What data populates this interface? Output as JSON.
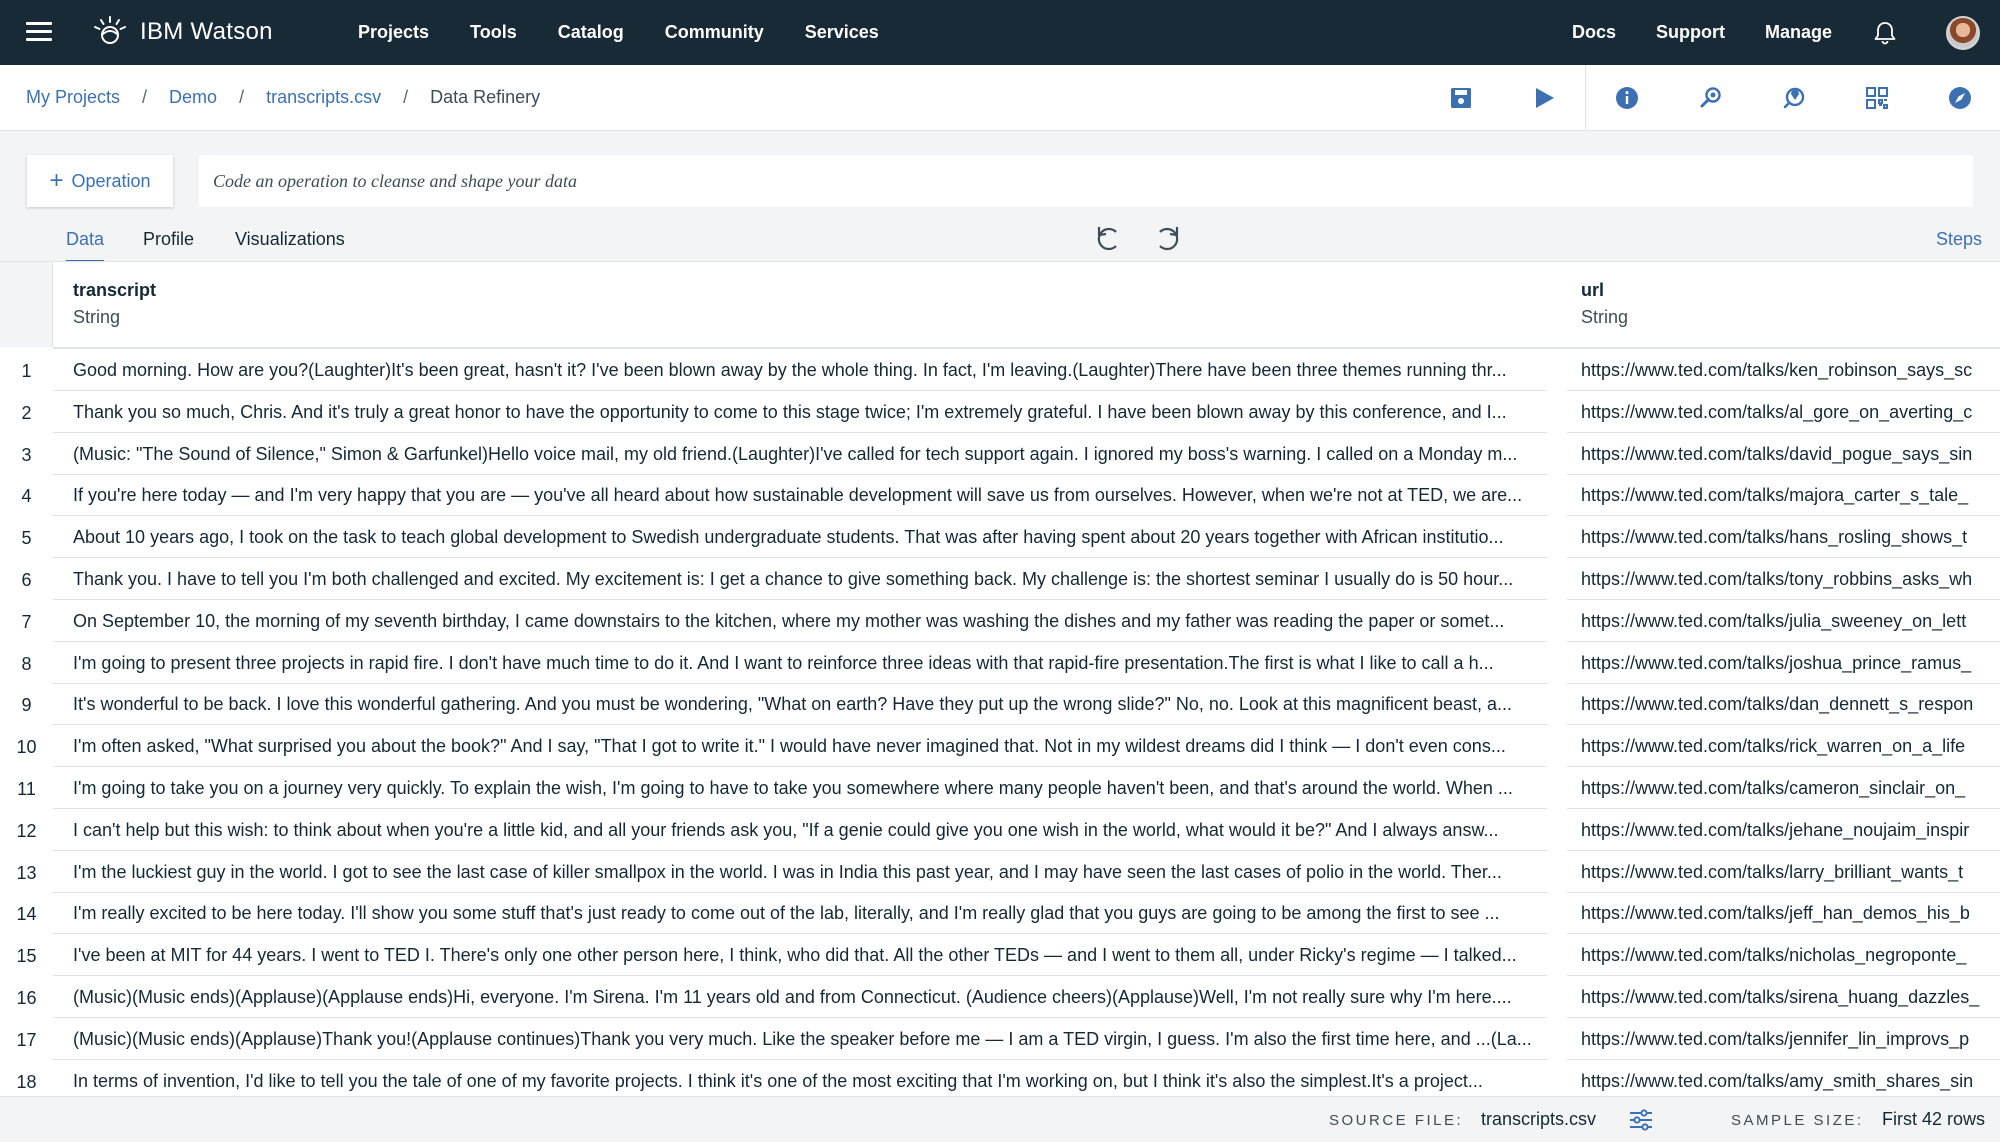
{
  "topnav": {
    "brand_prefix": "IBM",
    "brand_name": "Watson",
    "menu": [
      "Projects",
      "Tools",
      "Catalog",
      "Community",
      "Services"
    ],
    "right_links": [
      "Docs",
      "Support",
      "Manage"
    ],
    "icons": [
      "hamburger-menu-icon",
      "watson-logo-icon",
      "notification-bell-icon",
      "user-avatar"
    ]
  },
  "breadcrumb": {
    "items": [
      "My Projects",
      "Demo",
      "transcripts.csv"
    ],
    "current": "Data Refinery",
    "separator": "/"
  },
  "toolbar_icons": [
    "save-job-icon",
    "run-icon",
    "info-icon",
    "search-data-icon",
    "environment-icon",
    "layout-grid-icon",
    "compass-icon"
  ],
  "operation": {
    "button_label": "Operation",
    "code_placeholder": "Code an operation to cleanse and shape your data"
  },
  "tabs": {
    "items": [
      "Data",
      "Profile",
      "Visualizations"
    ],
    "active": "Data",
    "steps_label": "Steps"
  },
  "table": {
    "columns": [
      {
        "name": "transcript",
        "type": "String"
      },
      {
        "name": "url",
        "type": "String"
      }
    ],
    "rows": [
      {
        "n": "1",
        "transcript": "Good morning. How are you?(Laughter)It's been great, hasn't it? I've been blown away by the whole thing. In fact, I'm leaving.(Laughter)There have been three themes running thr...",
        "url": "https://www.ted.com/talks/ken_robinson_says_sc"
      },
      {
        "n": "2",
        "transcript": "Thank you so much, Chris. And it's truly a great honor to have the opportunity to come to this stage twice; I'm extremely grateful. I have been blown away by this conference, and I...",
        "url": "https://www.ted.com/talks/al_gore_on_averting_c"
      },
      {
        "n": "3",
        "transcript": "(Music: \"The Sound of Silence,\" Simon & Garfunkel)Hello voice mail, my old friend.(Laughter)I've called for tech support again. I ignored my boss's warning. I called on a Monday m...",
        "url": "https://www.ted.com/talks/david_pogue_says_sin"
      },
      {
        "n": "4",
        "transcript": "If you're here today — and I'm very happy that you are — you've all heard about how sustainable development will save us from ourselves. However, when we're not at TED, we are...",
        "url": "https://www.ted.com/talks/majora_carter_s_tale_"
      },
      {
        "n": "5",
        "transcript": "About 10 years ago, I took on the task to teach global development to Swedish undergraduate students. That was after having spent about 20 years together with African institutio...",
        "url": "https://www.ted.com/talks/hans_rosling_shows_t"
      },
      {
        "n": "6",
        "transcript": "Thank you. I have to tell you I'm both challenged and excited. My excitement is: I get a chance to give something back. My challenge is: the shortest seminar I usually do is 50 hour...",
        "url": "https://www.ted.com/talks/tony_robbins_asks_wh"
      },
      {
        "n": "7",
        "transcript": "On September 10, the morning of my seventh birthday, I came downstairs to the kitchen, where my mother was washing the dishes and my father was reading the paper or somet...",
        "url": "https://www.ted.com/talks/julia_sweeney_on_lett"
      },
      {
        "n": "8",
        "transcript": "I'm going to present three projects in rapid fire. I don't have much time to do it. And I want to reinforce three ideas with that rapid-fire presentation.The first is what I like to call a h...",
        "url": "https://www.ted.com/talks/joshua_prince_ramus_"
      },
      {
        "n": "9",
        "transcript": "It's wonderful to be back. I love this wonderful gathering. And you must be wondering, \"What on earth? Have they put up the wrong slide?\" No, no. Look at this magnificent beast, a...",
        "url": "https://www.ted.com/talks/dan_dennett_s_respon"
      },
      {
        "n": "10",
        "transcript": "I'm often asked, \"What surprised you about the book?\" And I say, \"That I got to write it.\" I would have never imagined that. Not in my wildest dreams did I think — I don't even cons...",
        "url": "https://www.ted.com/talks/rick_warren_on_a_life"
      },
      {
        "n": "11",
        "transcript": "I'm going to take you on a journey very quickly. To explain the wish, I'm going to have to take you somewhere where many people haven't been, and that's around the world. When ...",
        "url": "https://www.ted.com/talks/cameron_sinclair_on_"
      },
      {
        "n": "12",
        "transcript": "I can't help but this wish: to think about when you're a little kid, and all your friends ask you, \"If a genie could give you one wish in the world, what would it be?\" And I always answ...",
        "url": "https://www.ted.com/talks/jehane_noujaim_inspir"
      },
      {
        "n": "13",
        "transcript": "I'm the luckiest guy in the world. I got to see the last case of killer smallpox in the world. I was in India this past year, and I may have seen the last cases of polio in the world. Ther...",
        "url": "https://www.ted.com/talks/larry_brilliant_wants_t"
      },
      {
        "n": "14",
        "transcript": "I'm really excited to be here today. I'll show you some stuff that's just ready to come out of the lab, literally, and I'm really glad that you guys are going to be among the first to see ...",
        "url": "https://www.ted.com/talks/jeff_han_demos_his_b"
      },
      {
        "n": "15",
        "transcript": "I've been at MIT for 44 years. I went to TED I. There's only one other person here, I think, who did that. All the other TEDs — and I went to them all, under Ricky's regime — I talked...",
        "url": "https://www.ted.com/talks/nicholas_negroponte_"
      },
      {
        "n": "16",
        "transcript": "(Music)(Music ends)(Applause)(Applause ends)Hi, everyone. I'm Sirena. I'm 11 years old and from Connecticut. (Audience cheers)(Applause)Well, I'm not really sure why I'm here....",
        "url": "https://www.ted.com/talks/sirena_huang_dazzles_"
      },
      {
        "n": "17",
        "transcript": "(Music)(Music ends)(Applause)Thank you!(Applause continues)Thank you very much. Like the speaker before me — I am a TED virgin, I guess. I'm also the first time here, and ...(La...",
        "url": "https://www.ted.com/talks/jennifer_lin_improvs_p"
      },
      {
        "n": "18",
        "transcript": "In terms of invention, I'd like to tell you the tale of one of my favorite projects. I think it's one of the most exciting that I'm working on, but I think it's also the simplest.It's a project...",
        "url": "https://www.ted.com/talks/amy_smith_shares_sin"
      }
    ]
  },
  "footer": {
    "source_label": "SOURCE FILE:",
    "source_value": "transcripts.csv",
    "sample_label": "SAMPLE SIZE:",
    "sample_value": "First 42 rows"
  },
  "colors": {
    "topbar": "#172a36",
    "accent": "#3d70b2",
    "background": "#f3f4f5"
  }
}
